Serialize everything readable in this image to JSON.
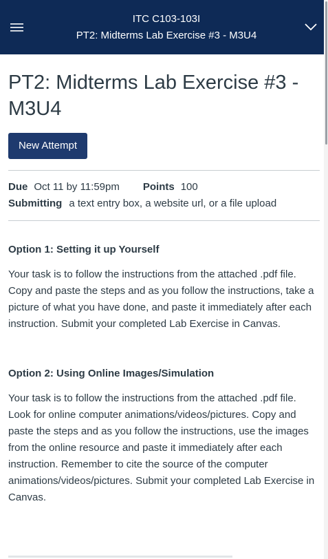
{
  "topbar": {
    "course": "ITC C103-103I",
    "assignment": "PT2: Midterms Lab Exercise #3 - M3U4",
    "menu_icon": "hamburger-icon",
    "expand_icon": "chevron-down-icon",
    "background": "#0e2a56"
  },
  "page": {
    "title": "PT2: Midterms Lab Exercise #3 - M3U4",
    "new_attempt_label": "New Attempt"
  },
  "details": {
    "due_label": "Due",
    "due_value": "Oct 11 by 11:59pm",
    "points_label": "Points",
    "points_value": "100",
    "submitting_label": "Submitting",
    "submitting_value": "a text entry box, a website url, or a file upload"
  },
  "description": {
    "option1_heading": "Option 1: Setting it up Yourself",
    "option1_body": "Your task is to follow the instructions from the attached .pdf file.  Copy and paste the steps and as you follow the instructions, take a picture of what you have done, and paste it immediately after each instruction.  Submit your completed Lab Exercise in Canvas.",
    "option2_heading": "Option 2: Using Online Images/Simulation",
    "option2_body": "Your task is to follow the instructions from the attached .pdf file.  Look for online computer animations/videos/pictures. Copy and paste the steps and as you follow the instructions, use the images from the online resource and paste it immediately after each instruction.  Remember to cite the source of the computer animations/videos/pictures.  Submit your completed Lab Exercise in Canvas."
  },
  "colors": {
    "accent_button": "#1e3a6e",
    "text": "#2d3b45"
  }
}
